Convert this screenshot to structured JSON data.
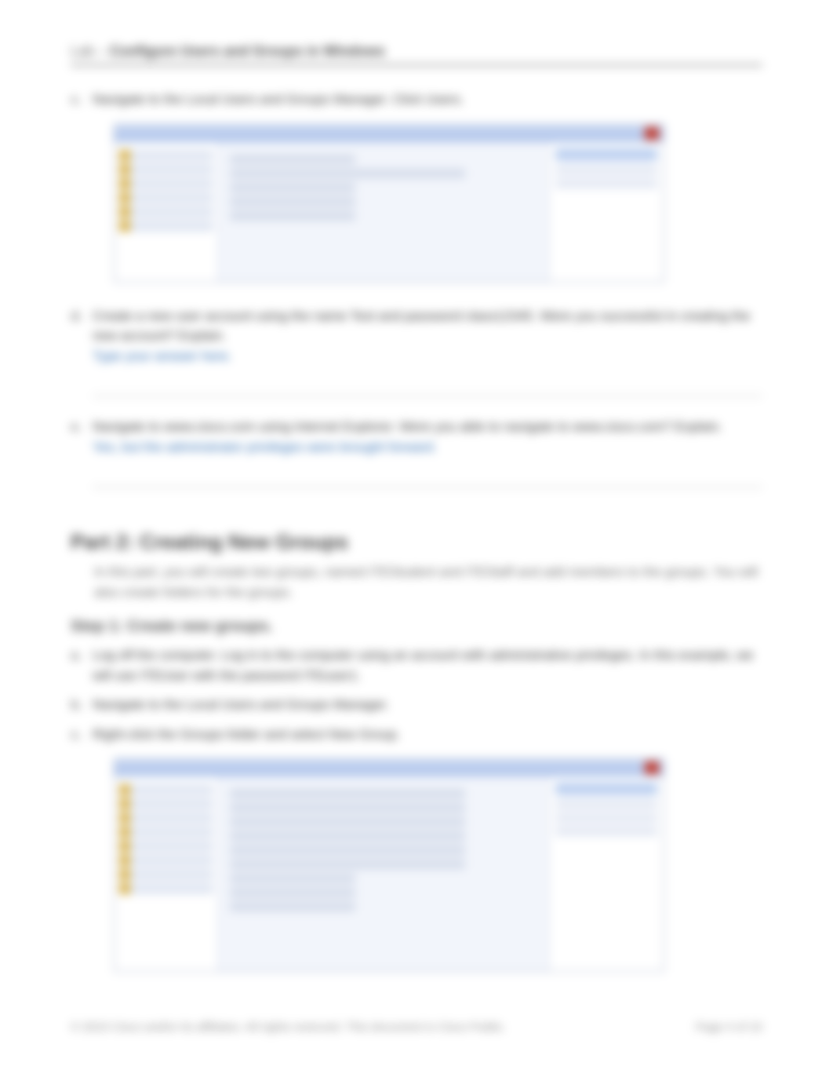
{
  "header": {
    "prefix": "Lab – ",
    "title": "Configure Users and Groups in Windows"
  },
  "section1": {
    "items": [
      {
        "bullet": "c.",
        "text": "Navigate to the Local Users and Groups Manager. Click Users."
      },
      {
        "bullet": "d.",
        "text": "Create a new user account using the name Test and password class12345. Were you successful in creating the new account? Explain.",
        "link": "Type your answer here.",
        "has_line": true
      },
      {
        "bullet": "e.",
        "text": "Navigate to www.cisco.com using Internet Explorer. Were you able to navigate to www.cisco.com? Explain.",
        "link": "Yes, but the administrator privileges were brought forward.",
        "has_line": true
      }
    ]
  },
  "part2": {
    "heading": "Part 2: Creating New Groups",
    "body": "In this part, you will create two groups, named ITEStudent and ITEStaff and add members to the groups. You will also create folders for the groups.",
    "step_heading": "Step 1: Create new groups.",
    "items": [
      {
        "bullet": "a.",
        "text": "Log off the computer. Log in to the computer using an account with administrative privileges. In this example, we will use ITEUser with the password ITEuser1."
      },
      {
        "bullet": "b.",
        "text": "Navigate to the Local Users and Groups Manager."
      },
      {
        "bullet": "c.",
        "text": "Right-click the Groups folder and select New Group."
      }
    ]
  },
  "footer": {
    "left": "© 2015 Cisco and/or its affiliates. All rights reserved. This document is Cisco Public.",
    "right": "Page 4 of 10"
  }
}
